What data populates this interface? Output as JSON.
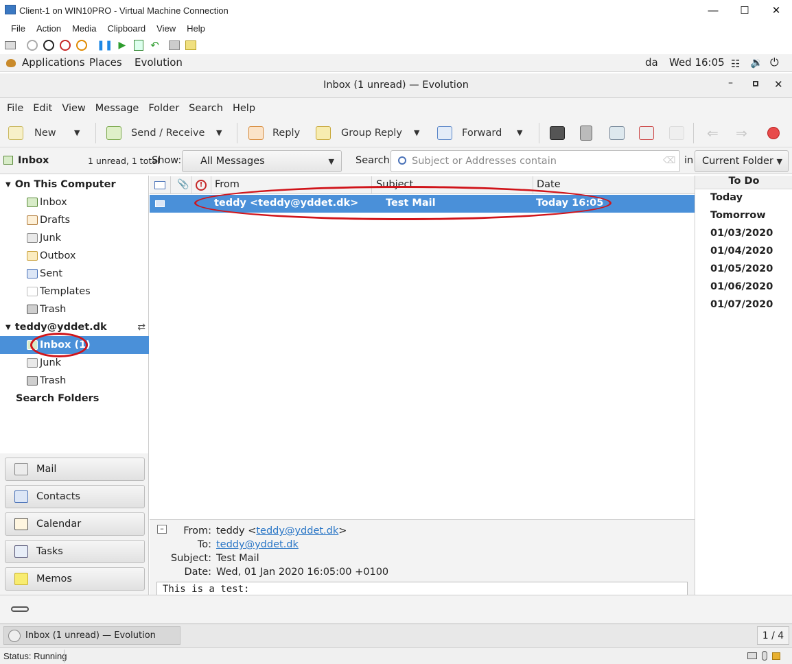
{
  "host": {
    "title": "Client-1 on WIN10PRO - Virtual Machine Connection",
    "menu": [
      "File",
      "Action",
      "Media",
      "Clipboard",
      "View",
      "Help"
    ],
    "status": "Status: Running"
  },
  "panel": {
    "applications": "Applications",
    "places": "Places",
    "evolution": "Evolution",
    "lang": "da",
    "clock": "Wed 16:05"
  },
  "evo": {
    "title": "Inbox (1 unread) — Evolution",
    "menu": [
      "File",
      "Edit",
      "View",
      "Message",
      "Folder",
      "Search",
      "Help"
    ],
    "toolbar": {
      "new": "New",
      "send_receive": "Send / Receive",
      "reply": "Reply",
      "group_reply": "Group Reply",
      "forward": "Forward"
    },
    "folder_header": {
      "name": "Inbox",
      "count": "1 unread, 1 total"
    },
    "filter": {
      "show_label": "Show:",
      "show_value": "All Messages",
      "search_label": "Search:",
      "search_placeholder": "Subject or Addresses contain",
      "in_label": "in",
      "scope": "Current Folder"
    },
    "tree": {
      "local": {
        "label": "On This Computer",
        "folders": [
          "Inbox",
          "Drafts",
          "Junk",
          "Outbox",
          "Sent",
          "Templates",
          "Trash"
        ]
      },
      "account": {
        "label": "teddy@yddet.dk",
        "folders": [
          "Inbox (1)",
          "Junk",
          "Trash"
        ]
      },
      "search_folders": "Search Folders"
    },
    "switcher": [
      "Mail",
      "Contacts",
      "Calendar",
      "Tasks",
      "Memos"
    ],
    "list_columns": {
      "from": "From",
      "subject": "Subject",
      "date": "Date"
    },
    "messages": [
      {
        "from": "teddy <teddy@yddet.dk>",
        "subject": "Test Mail",
        "date": "Today 16:05"
      }
    ],
    "preview": {
      "from_label": "From:",
      "from_name": "teddy <",
      "from_email": "teddy@yddet.dk",
      "from_close": ">",
      "to_label": "To:",
      "to_email": "teddy@yddet.dk",
      "subject_label": "Subject:",
      "subject": "Test Mail",
      "date_label": "Date:",
      "date": "Wed, 01 Jan 2020 16:05:00 +0100",
      "body": "This is a test:"
    },
    "todo": {
      "title": "To Do",
      "items": [
        "Today",
        "Tomorrow",
        "01/03/2020",
        "01/04/2020",
        "01/05/2020",
        "01/06/2020",
        "01/07/2020"
      ]
    },
    "taskbar": {
      "window": "Inbox (1 unread) — Evolution",
      "workspace": "1 / 4"
    }
  },
  "colors": {
    "selection": "#4a90d9",
    "annotation": "#d0141a",
    "link": "#2a76c6"
  }
}
